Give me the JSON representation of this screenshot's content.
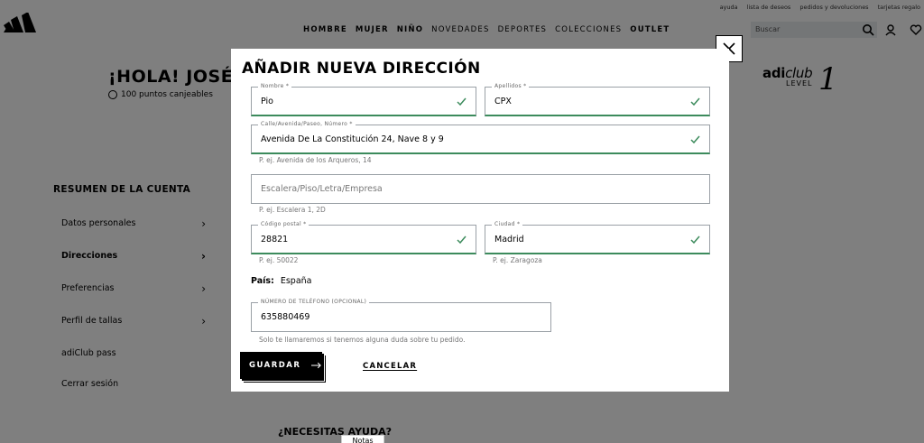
{
  "top_links": [
    "ayuda",
    "lista de deseos",
    "pedidos y devoluciones",
    "tarjetas regalo"
  ],
  "nav": [
    {
      "label": "HOMBRE",
      "bold": true
    },
    {
      "label": "MUJER",
      "bold": true
    },
    {
      "label": "NIÑO",
      "bold": true
    },
    {
      "label": "NOVEDADES",
      "bold": false
    },
    {
      "label": "DEPORTES",
      "bold": false
    },
    {
      "label": "COLECCIONES",
      "bold": false
    },
    {
      "label": "OUTLET",
      "bold": true
    }
  ],
  "search": {
    "placeholder": "Buscar"
  },
  "profile": {
    "greeting": "¡HOLA! JOSÉ PA",
    "points": "100 puntos canjeables",
    "adiclub_brand_bold": "adi",
    "adiclub_brand_italic": "club",
    "level_label": "LEVEL",
    "level_number": "1"
  },
  "account": {
    "title": "RESUMEN DE LA CUENTA",
    "items": [
      "Datos personales",
      "Direcciones",
      "Preferencias",
      "Perfil de tallas",
      "adiClub pass",
      "Cerrar sesión"
    ],
    "help": "¿NECESITAS AYUDA?",
    "notes_tab": "Notas"
  },
  "modal": {
    "title": "AÑADIR NUEVA DIRECCIÓN",
    "fields": {
      "nombre": {
        "label": "Nombre *",
        "value": "Pio"
      },
      "apellidos": {
        "label": "Apellidos *",
        "value": "CPX"
      },
      "calle": {
        "label": "Calle/Avenida/Paseo, Número *",
        "value": "Avenida De La Constitución 24, Nave 8 y 9",
        "hint": "P. ej. Avenida de los Arqueros, 14"
      },
      "escalera": {
        "placeholder": "Escalera/Piso/Letra/Empresa",
        "hint": "P. ej. Escalera 1, 2D"
      },
      "cp": {
        "label": "Código postal *",
        "value": "28821",
        "hint": "P. ej. 50022"
      },
      "ciudad": {
        "label": "Ciudad *",
        "value": "Madrid",
        "hint": "P. ej. Zaragoza"
      },
      "telefono": {
        "label": "NÚMERO DE TELÉFONO (OPCIONAL)",
        "value": "635880469",
        "hint": "Solo te llamaremos si tenemos alguna duda sobre tu pedido."
      }
    },
    "country_label": "País:",
    "country_value": "España",
    "save_label": "GUARDAR",
    "cancel_label": "CANCELAR"
  },
  "colors": {
    "valid_green": "#3c8b5c",
    "overlay": "#000000"
  }
}
